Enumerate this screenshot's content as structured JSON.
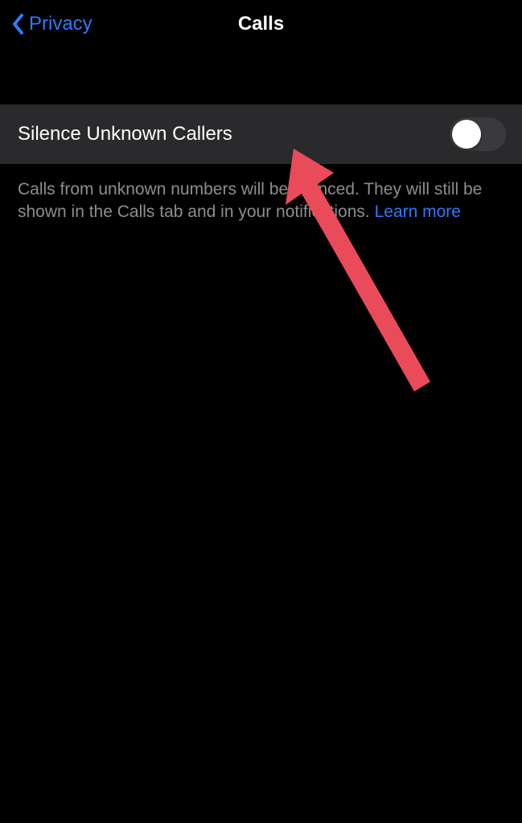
{
  "header": {
    "back_label": "Privacy",
    "title": "Calls"
  },
  "settings": {
    "silence_unknown": {
      "label": "Silence Unknown Callers",
      "enabled": false
    }
  },
  "description": {
    "text_before": "Calls from unknown numbers will be silenced. They will still be shown in the Calls tab and in your notifications. ",
    "learn_more": "Learn more"
  },
  "colors": {
    "accent": "#3478f6",
    "row_bg": "#2a2a2c",
    "toggle_off": "#3a3a3c",
    "description_text": "#8d8d93",
    "annotation": "#e94b5a"
  }
}
